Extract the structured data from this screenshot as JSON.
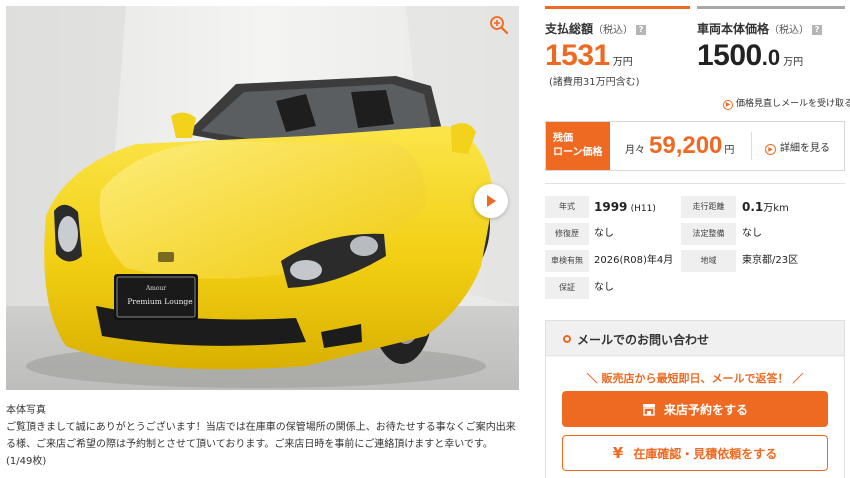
{
  "photo": {
    "zoom_icon": "zoom-in-icon",
    "next_icon": "play-arrow-icon",
    "plate_line1": "Amour",
    "plate_line2": "Premium Lounge",
    "caption_title": "本体写真",
    "caption_text": "ご覧頂きまして誠にありがとうございます！当店では在庫車の保管場所の関係上、お待たせする事なくご案内出来る様、ご来店ご希望の際は予約制とさせて頂いております。ご来店日時を事前にご連絡頂けますと幸いです。",
    "counter": "(1/49枚)"
  },
  "price": {
    "total_label": "支払総額",
    "total_tax": "（税込）",
    "total_value": "1531",
    "total_unit": "万円",
    "total_note": "(諸費用31万円含む)",
    "body_label": "車両本体価格",
    "body_tax": "（税込）",
    "body_value_int": "1500",
    "body_value_dec": ".0",
    "body_unit": "万円",
    "help_mark": "?",
    "alert_link": "価格見直しメールを受け取る"
  },
  "loan": {
    "tag_line1": "残価",
    "tag_line2": "ローン価格",
    "monthly_prefix": "月々",
    "monthly_amount": "59,200",
    "monthly_unit": "円",
    "detail_link": "詳細を見る"
  },
  "specs": {
    "year_label": "年式",
    "year_value": "1999",
    "year_era": "(H11)",
    "mileage_label": "走行距離",
    "mileage_value": "0.1",
    "mileage_unit": "万km",
    "repair_label": "修復歴",
    "repair_value": "なし",
    "maintenance_label": "法定整備",
    "maintenance_value": "なし",
    "inspection_label": "車検有無",
    "inspection_value": "2026(R08)年4月",
    "region_label": "地域",
    "region_value": "東京都/23区",
    "warranty_label": "保証",
    "warranty_value": "なし"
  },
  "inquiry": {
    "title": "メールでのお問い合わせ",
    "promo": "＼ 販売店から最短即日、メールで返答！ ／",
    "visit_button": "来店予約をする",
    "estimate_button": "在庫確認・見積依頼をする",
    "estimate_icon_glyph": "¥"
  },
  "colors": {
    "accent": "#ee6a22",
    "car_yellow": "#f2d21a"
  }
}
